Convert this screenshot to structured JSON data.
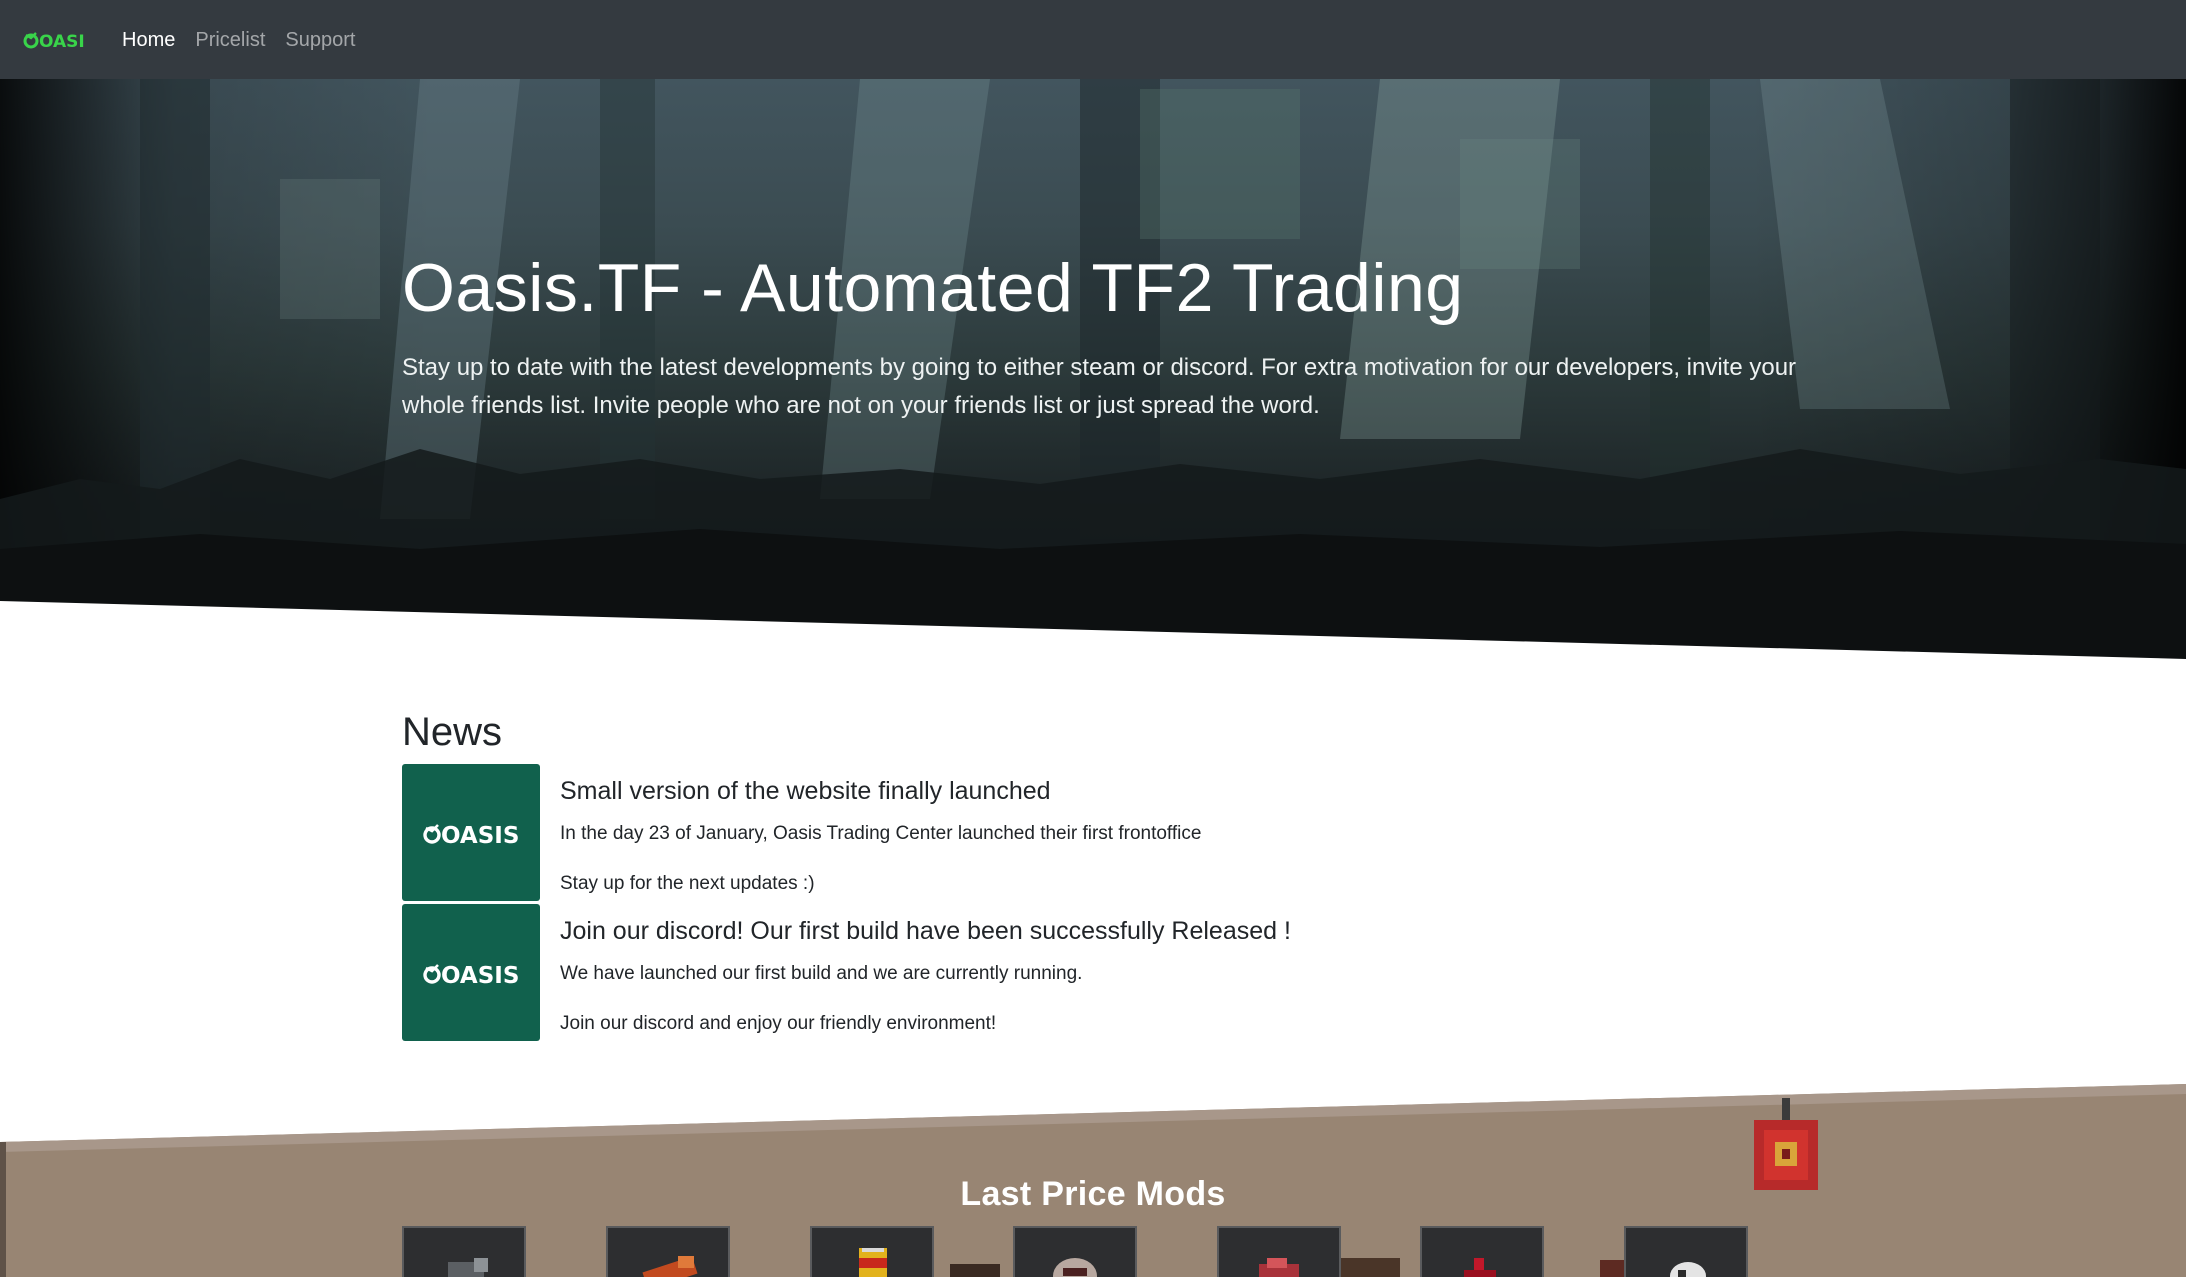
{
  "navbar": {
    "brand": "OASIS",
    "links": [
      {
        "label": "Home",
        "active": true
      },
      {
        "label": "Pricelist",
        "active": false
      },
      {
        "label": "Support",
        "active": false
      }
    ]
  },
  "hero": {
    "title": "Oasis.TF - Automated TF2 Trading",
    "lead": "Stay up to date with the latest developments by going to either steam or discord. For extra motivation for our developers, invite your whole friends list. Invite people who are not on your friends list or just spread the word."
  },
  "news": {
    "heading": "News",
    "items": [
      {
        "logo": "OASIS",
        "title": "Small version of the website finally launched",
        "paragraphs": [
          "In the day 23 of January, Oasis Trading Center launched their first frontoffice",
          "Stay up for the next updates :)"
        ]
      },
      {
        "logo": "OASIS",
        "title": "Join our discord! Our first build have been successfully Released !",
        "paragraphs": [
          "We have launched our first build and we are currently running.",
          "Join our discord and enjoy our friendly environment!"
        ]
      }
    ]
  },
  "price_mods": {
    "heading": "Last Price Mods",
    "items": [
      {
        "icon": "item-icon-gray"
      },
      {
        "icon": "item-icon-orange"
      },
      {
        "icon": "item-icon-can"
      },
      {
        "icon": "item-icon-mask"
      },
      {
        "icon": "item-icon-red"
      },
      {
        "icon": "item-icon-red-dark"
      },
      {
        "icon": "item-icon-white"
      }
    ]
  },
  "colors": {
    "navbar_bg": "#343a40",
    "brand_green": "#39d44a",
    "news_thumb_bg": "#11614d",
    "mods_bg": "#988573"
  }
}
